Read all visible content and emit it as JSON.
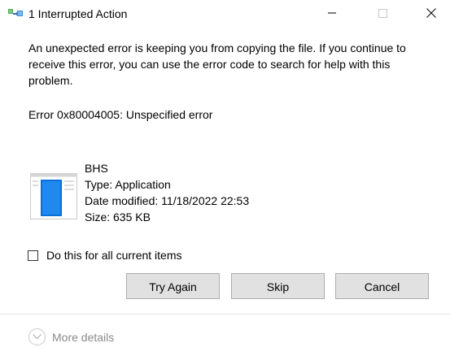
{
  "window": {
    "title": "1 Interrupted Action",
    "icon": "copy-transfer-icon",
    "caption_buttons": [
      "minimize-icon",
      "maximize-icon",
      "close-icon"
    ]
  },
  "message": {
    "body": "An unexpected error is keeping you from copying the file. If you continue to receive this error, you can use the error code to search for help with this problem.",
    "error_code": "Error 0x80004005: Unspecified error"
  },
  "file": {
    "icon": "application-file-icon",
    "name": "BHS",
    "type": "Type: Application",
    "date_modified": "Date modified: 11/18/2022 22:53",
    "size": "Size: 635 KB"
  },
  "checkbox": {
    "label": "Do this for all current items",
    "checked": false
  },
  "buttons": {
    "try_again": "Try Again",
    "skip": "Skip",
    "cancel": "Cancel"
  },
  "footer": {
    "more_details": "More details",
    "icon": "chevron-down-icon"
  },
  "colors": {
    "button_bg": "#e1e1e1",
    "button_border": "#adadad",
    "accent_blue": "#0078d7",
    "muted_text": "#8a8a8a"
  }
}
